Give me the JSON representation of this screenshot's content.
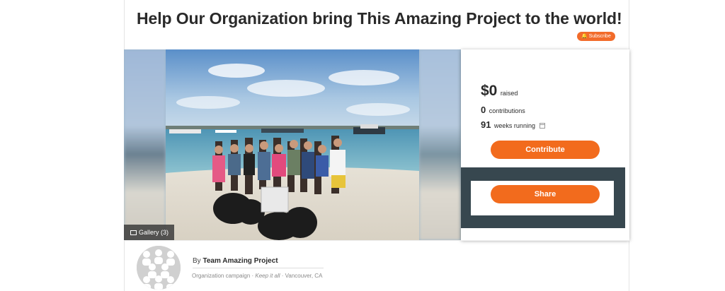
{
  "campaign": {
    "title": "Help Our Organization bring This Amazing Project to the world!",
    "subscribe_label": "Subscribe",
    "gallery_label": "Gallery (3)"
  },
  "stats": {
    "raised_amount": "$0",
    "raised_label": "raised",
    "contributions_count": "0",
    "contributions_label": "contributions",
    "weeks_count": "91",
    "weeks_label": "weeks running"
  },
  "actions": {
    "contribute_label": "Contribute",
    "share_label": "Share"
  },
  "author": {
    "by_prefix": "By",
    "name": "Team Amazing Project",
    "campaign_type": "Organization campaign",
    "funding_type": "Keep it all",
    "location": "Vancouver, CA"
  },
  "colors": {
    "accent": "#f26b1d",
    "highlight_overlay": "#37474f"
  },
  "icons": [
    "bell-icon",
    "gallery-icon",
    "calendar-icon"
  ]
}
